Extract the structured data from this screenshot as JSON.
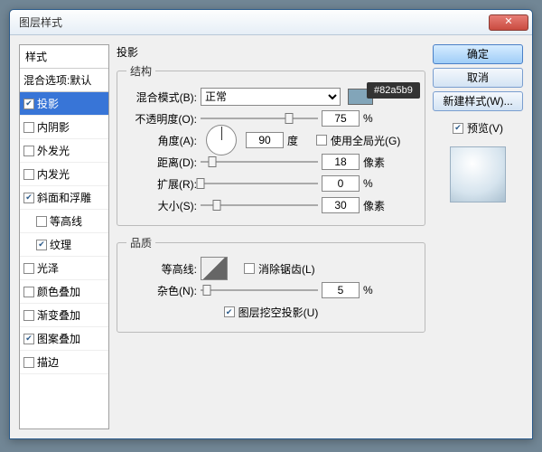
{
  "window": {
    "title": "图层样式"
  },
  "sidebar": {
    "header": "样式",
    "blend": "混合选项:默认",
    "items": [
      {
        "label": "投影",
        "checked": true,
        "selected": true
      },
      {
        "label": "内阴影",
        "checked": false
      },
      {
        "label": "外发光",
        "checked": false
      },
      {
        "label": "内发光",
        "checked": false
      },
      {
        "label": "斜面和浮雕",
        "checked": true
      },
      {
        "label": "等高线",
        "checked": false,
        "indent": true
      },
      {
        "label": "纹理",
        "checked": true,
        "indent": true
      },
      {
        "label": "光泽",
        "checked": false
      },
      {
        "label": "颜色叠加",
        "checked": false
      },
      {
        "label": "渐变叠加",
        "checked": false
      },
      {
        "label": "图案叠加",
        "checked": true
      },
      {
        "label": "描边",
        "checked": false
      }
    ]
  },
  "panel": {
    "title": "投影",
    "group1": "结构",
    "group2": "品质",
    "blend_label": "混合模式(B):",
    "blend_value": "正常",
    "swatch_color": "#82a5b9",
    "opacity_label": "不透明度(O):",
    "opacity": "75",
    "angle_label": "角度(A):",
    "angle": "90",
    "angle_unit": "度",
    "global_light": "使用全局光(G)",
    "distance_label": "距离(D):",
    "distance": "18",
    "px": "像素",
    "spread_label": "扩展(R):",
    "spread": "0",
    "size_label": "大小(S):",
    "size": "30",
    "pct": "%",
    "contour_label": "等高线:",
    "antialias": "消除锯齿(L)",
    "noise_label": "杂色(N):",
    "noise": "5",
    "knockout": "图层挖空投影(U)"
  },
  "buttons": {
    "ok": "确定",
    "cancel": "取消",
    "newstyle": "新建样式(W)...",
    "preview": "预览(V)"
  },
  "tooltip": "#82a5b9"
}
